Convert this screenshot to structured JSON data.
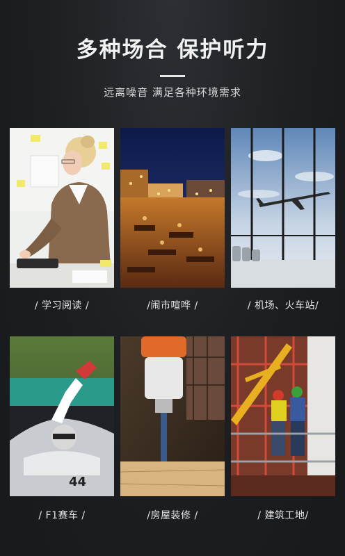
{
  "header": {
    "title": "多种场合 保护听力",
    "subtitle": "远离噪音 满足各种环境需求"
  },
  "scenes": [
    {
      "caption": "/ 学习阅读 /",
      "icon": "office-reading-photo"
    },
    {
      "caption": "/闹市喧哗 /",
      "icon": "busy-street-market-photo"
    },
    {
      "caption": "/ 机场、火车站/",
      "icon": "airport-airplane-photo"
    },
    {
      "caption": "/ F1赛车 /",
      "icon": "f1-racing-photo"
    },
    {
      "caption": "/房屋装修 /",
      "icon": "power-drill-photo"
    },
    {
      "caption": "/ 建筑工地/",
      "icon": "construction-site-photo"
    }
  ]
}
